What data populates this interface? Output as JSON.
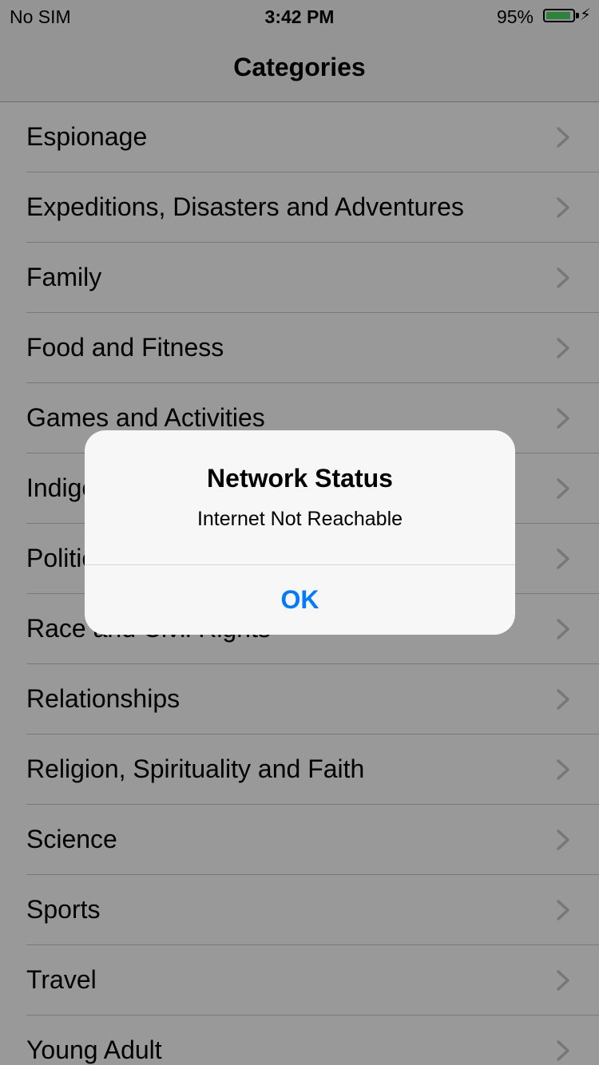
{
  "status_bar": {
    "carrier": "No SIM",
    "time": "3:42 PM",
    "battery_percent": "95%",
    "battery_level": 0.95,
    "battery_color": "#4cd964",
    "charging_icon": "lightning-bolt-icon"
  },
  "nav": {
    "title": "Categories"
  },
  "categories": [
    {
      "label": "Espionage"
    },
    {
      "label": "Expeditions, Disasters and Adventures"
    },
    {
      "label": "Family"
    },
    {
      "label": "Food and Fitness"
    },
    {
      "label": "Games and Activities"
    },
    {
      "label": "Indigenous"
    },
    {
      "label": "Politics"
    },
    {
      "label": "Race and Civil Rights"
    },
    {
      "label": "Relationships"
    },
    {
      "label": "Religion, Spirituality and Faith"
    },
    {
      "label": "Science"
    },
    {
      "label": "Sports"
    },
    {
      "label": "Travel"
    },
    {
      "label": "Young Adult"
    }
  ],
  "alert": {
    "title": "Network Status",
    "message": "Internet Not Reachable",
    "button_label": "OK",
    "button_color": "#007aff"
  }
}
